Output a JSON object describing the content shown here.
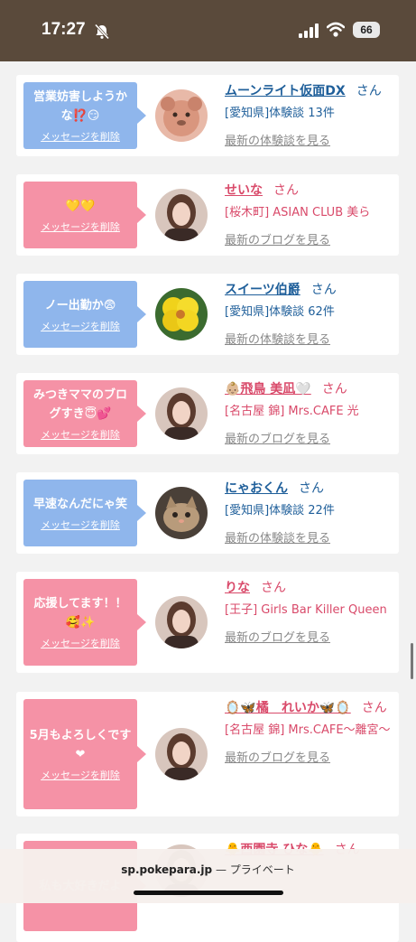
{
  "status_bar": {
    "time": "17:27",
    "battery": "66"
  },
  "cards": [
    {
      "bubble_color": "blue",
      "message": "営業妨害しようかな⁉️😏",
      "delete_label": "メッセージを削除",
      "name": "ムーンライト仮面DX",
      "honorific": "さん",
      "name_color": "blue",
      "shop": "[愛知県]体験談 13件",
      "latest": "最新の体験談を見る",
      "avatar": "plush"
    },
    {
      "bubble_color": "pink",
      "message": "💛💛",
      "delete_label": "メッセージを削除",
      "name": "せいな",
      "honorific": "さん",
      "name_color": "pink",
      "shop": "[桜木町] ASIAN CLUB 美ら",
      "latest": "最新のブログを見る",
      "avatar": "woman"
    },
    {
      "bubble_color": "blue",
      "message": "ノー出勤か😨",
      "delete_label": "メッセージを削除",
      "name": "スイーツ伯爵",
      "honorific": "さん",
      "name_color": "blue",
      "shop": "[愛知県]体験談 62件",
      "latest": "最新の体験談を見る",
      "avatar": "flower"
    },
    {
      "bubble_color": "pink",
      "message": "みつきママのブログすき😇💕",
      "delete_label": "メッセージを削除",
      "name": "👶🏼飛鳥 美凪🤍",
      "honorific": "さん",
      "name_color": "pink",
      "shop": "[名古屋 錦] Mrs.CAFE 光",
      "latest": "最新のブログを見る",
      "avatar": "woman"
    },
    {
      "bubble_color": "blue",
      "message": "早速なんだにゃ笑",
      "delete_label": "メッセージを削除",
      "name": "にゃおくん",
      "honorific": "さん",
      "name_color": "blue",
      "shop": "[愛知県]体験談 22件",
      "latest": "最新の体験談を見る",
      "avatar": "cat"
    },
    {
      "bubble_color": "pink",
      "message": "応援してます！！🥰✨",
      "delete_label": "メッセージを削除",
      "name": "りな",
      "honorific": "さん",
      "name_color": "pink",
      "shop": "[王子] Girls Bar Killer Queen",
      "latest": "最新のブログを見る",
      "avatar": "woman"
    },
    {
      "bubble_color": "pink",
      "message": "5月もよろしくです❤",
      "delete_label": "メッセージを削除",
      "name": "🪞🦋橘　れいか🦋🪞",
      "honorific": "さん",
      "name_color": "pink",
      "shop": "[名古屋 錦] Mrs.CAFE〜離宮〜",
      "latest": "最新のブログを見る",
      "avatar": "woman"
    },
    {
      "bubble_color": "pink",
      "message": "私も大好きだよ",
      "delete_label": "",
      "name": "🐥西園寺 ひな🐥",
      "honorific": "さん",
      "name_color": "pink",
      "shop": "",
      "latest": "",
      "avatar": "woman"
    }
  ],
  "browser": {
    "domain": "sp.pokepara.jp",
    "mode": "— プライベート"
  },
  "colors": {
    "blue_bubble": "#8fb6ec",
    "pink_bubble": "#f592a6",
    "blue_text": "#1f5f9a",
    "pink_text": "#d94a6a"
  }
}
